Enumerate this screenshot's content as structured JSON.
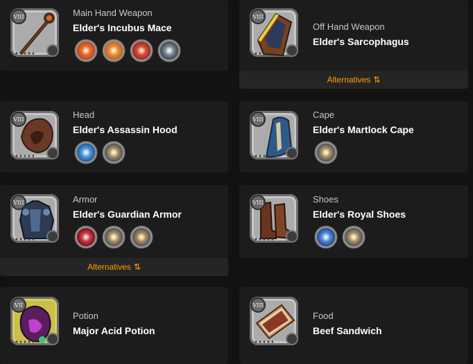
{
  "slots": [
    {
      "id": "main_hand",
      "slot_label": "Main Hand Weapon",
      "item_name": "Elder's Incubus Mace",
      "tier": "VIII",
      "spells": [
        {
          "icon": "fire-orb-icon",
          "color": "#e0661d"
        },
        {
          "icon": "flame-burst-icon",
          "color": "#d8761a"
        },
        {
          "icon": "fire-strike-icon",
          "color": "#c9421c"
        },
        {
          "icon": "lightning-icon",
          "color": "#5a6a7a"
        }
      ],
      "alternatives_label": null
    },
    {
      "id": "off_hand",
      "slot_label": "Off Hand Weapon",
      "item_name": "Elder's Sarcophagus",
      "tier": "VIII",
      "spells": [],
      "alternatives_label": "Alternatives",
      "alternatives_icon": "⇅"
    },
    {
      "id": "head",
      "slot_label": "Head",
      "item_name": "Elder's Assassin Hood",
      "tier": "VIII",
      "spells": [
        {
          "icon": "swirl-icon",
          "color": "#2e86d6"
        },
        {
          "icon": "fireball-icon",
          "color": "#e8861a"
        }
      ],
      "alternatives_label": null
    },
    {
      "id": "cape",
      "slot_label": "Cape",
      "item_name": "Elder's Martlock Cape",
      "tier": "VIII",
      "spells": [
        {
          "icon": "shield-icon",
          "color": "#f0a019"
        }
      ],
      "alternatives_label": null
    },
    {
      "id": "armor",
      "slot_label": "Armor",
      "item_name": "Elder's Guardian Armor",
      "tier": "VIII",
      "spells": [
        {
          "icon": "blood-drop-icon",
          "color": "#c0182a"
        },
        {
          "icon": "shield-fire-icon",
          "color": "#e88a1a"
        },
        {
          "icon": "burst-icon",
          "color": "#e6821a"
        }
      ],
      "alternatives_label": "Alternatives",
      "alternatives_icon": "⇅"
    },
    {
      "id": "shoes",
      "slot_label": "Shoes",
      "item_name": "Elder's Royal Shoes",
      "tier": "VIII",
      "spells": [
        {
          "icon": "dash-icon",
          "color": "#2c7fd0"
        },
        {
          "icon": "fireball-icon",
          "color": "#e8861a"
        }
      ],
      "alternatives_label": null
    },
    {
      "id": "potion",
      "slot_label": "Potion",
      "item_name": "Major Acid Potion",
      "tier": "VII",
      "spells": [],
      "alternatives_label": null
    },
    {
      "id": "food",
      "slot_label": "Food",
      "item_name": "Beef Sandwich",
      "tier": "VIII",
      "spells": [],
      "alternatives_label": null
    }
  ]
}
